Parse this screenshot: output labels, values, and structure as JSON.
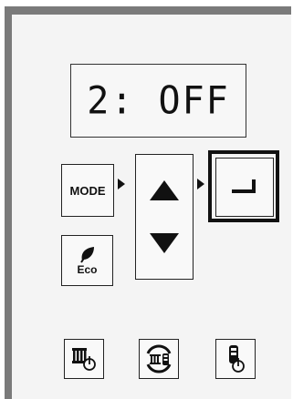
{
  "display": {
    "text": "2: OFF"
  },
  "buttons": {
    "mode_label": "MODE",
    "eco_label": "Eco",
    "up_icon": "up-triangle-icon",
    "down_icon": "down-triangle-icon",
    "enter_icon": "enter-return-icon",
    "heating_power_icon": "radiator-power-icon",
    "heating_battery_cycle_icon": "radiator-battery-cycle-icon",
    "battery_power_icon": "battery-power-icon"
  },
  "colors": {
    "frame": "#7a7a7a",
    "panel": "#f4f4f4",
    "ink": "#111111"
  }
}
